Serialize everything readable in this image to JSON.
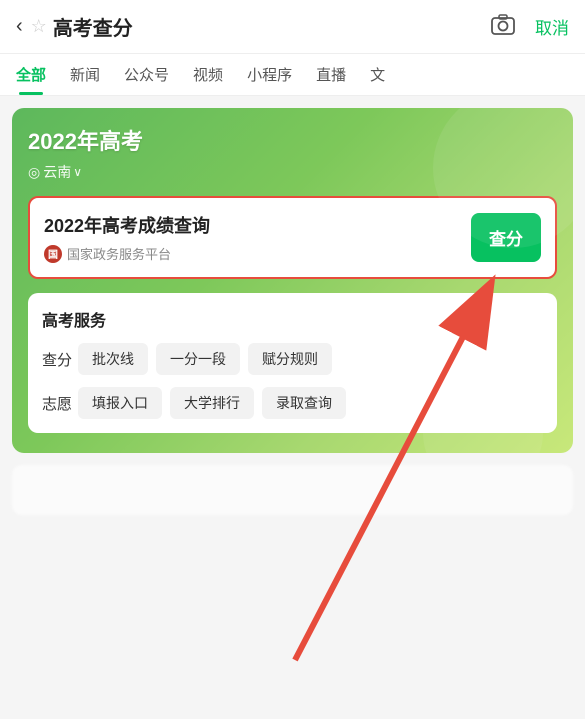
{
  "topBar": {
    "backLabel": "‹",
    "starLabel": "☆",
    "title": "高考查分",
    "cameraLabel": "⊙",
    "cancelLabel": "取消"
  },
  "tabs": [
    {
      "label": "全部",
      "active": true
    },
    {
      "label": "新闻",
      "active": false
    },
    {
      "label": "公众号",
      "active": false
    },
    {
      "label": "视频",
      "active": false
    },
    {
      "label": "小程序",
      "active": false
    },
    {
      "label": "直播",
      "active": false
    },
    {
      "label": "文",
      "active": false
    }
  ],
  "banner": {
    "year": "2022年高考",
    "locationPin": "◎",
    "location": "云南",
    "chevron": "∨"
  },
  "scoreCard": {
    "title": "2022年高考成绩查询",
    "sourceLogo": "国",
    "sourceText": "国家政务服务平台",
    "queryBtn": "查分"
  },
  "services": {
    "title": "高考服务",
    "rows": [
      {
        "label": "查分",
        "tags": [
          "批次线",
          "一分一段",
          "赋分规则"
        ]
      },
      {
        "label": "志愿",
        "tags": [
          "填报入口",
          "大学排行",
          "录取查询"
        ]
      }
    ]
  },
  "arrow": {
    "description": "red arrow pointing up-right to query button"
  }
}
